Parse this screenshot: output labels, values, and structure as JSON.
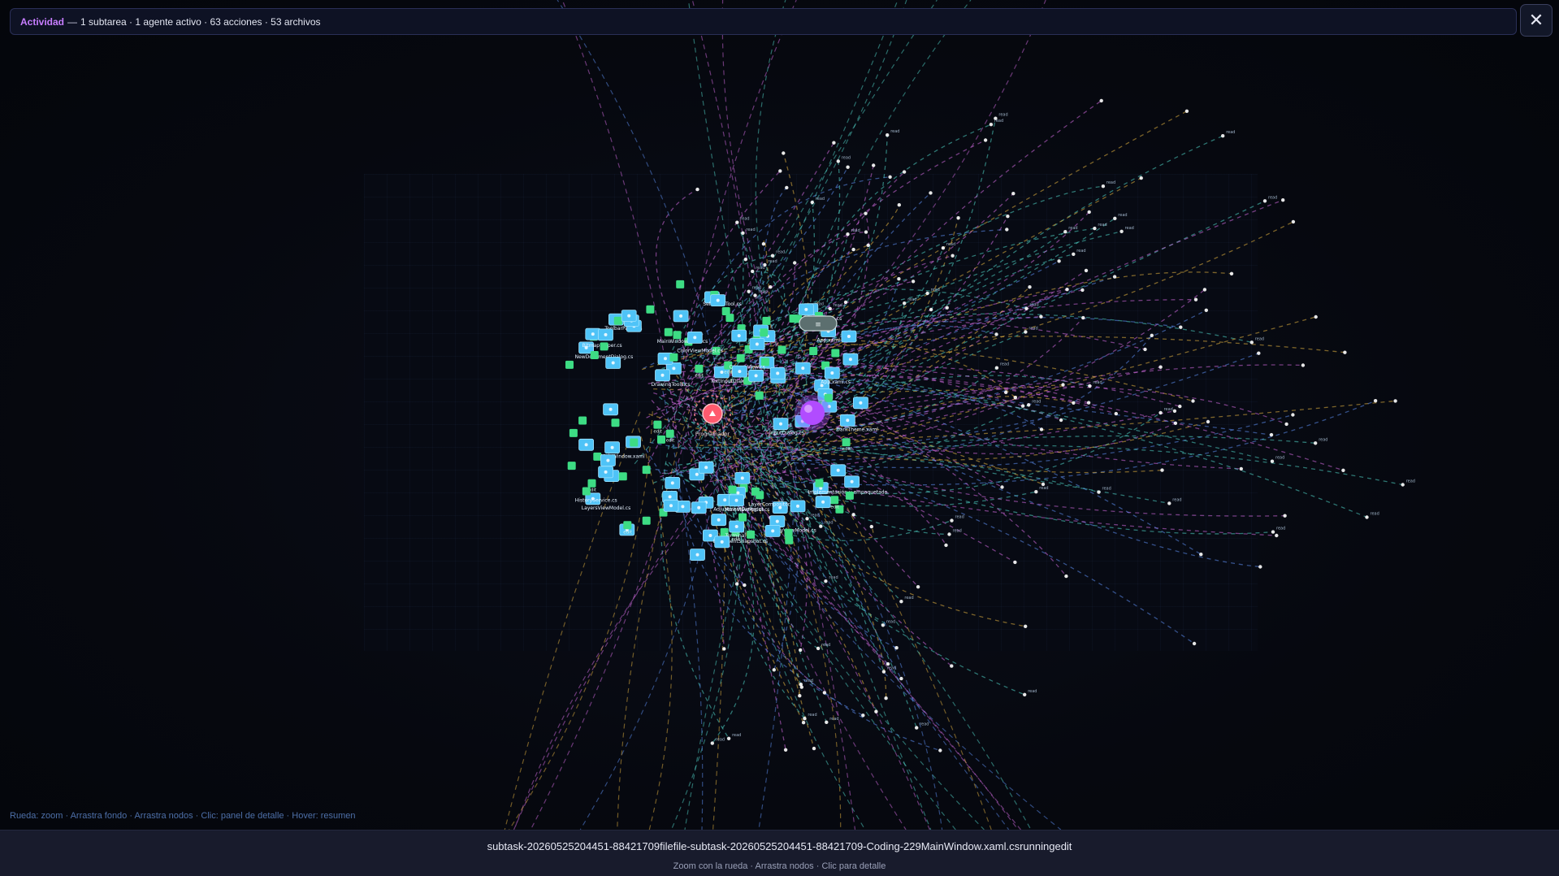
{
  "header": {
    "activity_label": "Actividad",
    "dash": "—",
    "summary": "1 subtarea · 1 agente activo · 63 acciones · 53 archivos",
    "close_icon": "close-icon"
  },
  "graph": {
    "colors": {
      "file_node": "#4fc3f7",
      "action_node": "#3ddc84",
      "agent_node": "#ff5a6e",
      "subtask_node": "#b14cff",
      "edge_cyan": "#4fd1c5",
      "edge_magenta": "#d06adf",
      "edge_blue": "#5b8def",
      "edge_yellow": "#e0b040"
    },
    "agent_label": "Programador",
    "pill_label": "≡",
    "file_labels": [
      "NewDocumentDialog.cs",
      "InputDialog.cs",
      "AdjustmentDialog.cs",
      "HistoryViewModel.cs",
      "LayersViewModel.cs",
      "TextInputDialog.cs",
      "ToolbarPanel.cs",
      "MainViewModel.cs",
      "ColorViewModel.cs",
      "DrawingTools.cs",
      "HistoryService.cs",
      "LayerCompositor.cs",
      "DocumentSnapshot.cs",
      "BitmapHelper.cs",
      "Terminal",
      "MainWindow.xaml",
      "MainWindow.xaml.cs",
      "App.xaml",
      "App.xaml.cs",
      "DarkTheme.xaml",
      "SelectionTool.cs",
      "CanvasView.cs",
      "ValueConverters.cs",
      "Implementación y empaquetado"
    ],
    "action_label": "edit",
    "remote_label": "read"
  },
  "hint": {
    "text": "Rueda: zoom · Arrastra fondo · Arrastra nodos · Clic: panel de detalle · Hover: resumen"
  },
  "footer": {
    "title": "subtask-20260525204451-88421709filefile-subtask-20260525204451-88421709-Coding-229MainWindow.xaml.csrunningedit",
    "subtitle": "Zoom con la rueda · Arrastra nodos · Clic para detalle"
  }
}
